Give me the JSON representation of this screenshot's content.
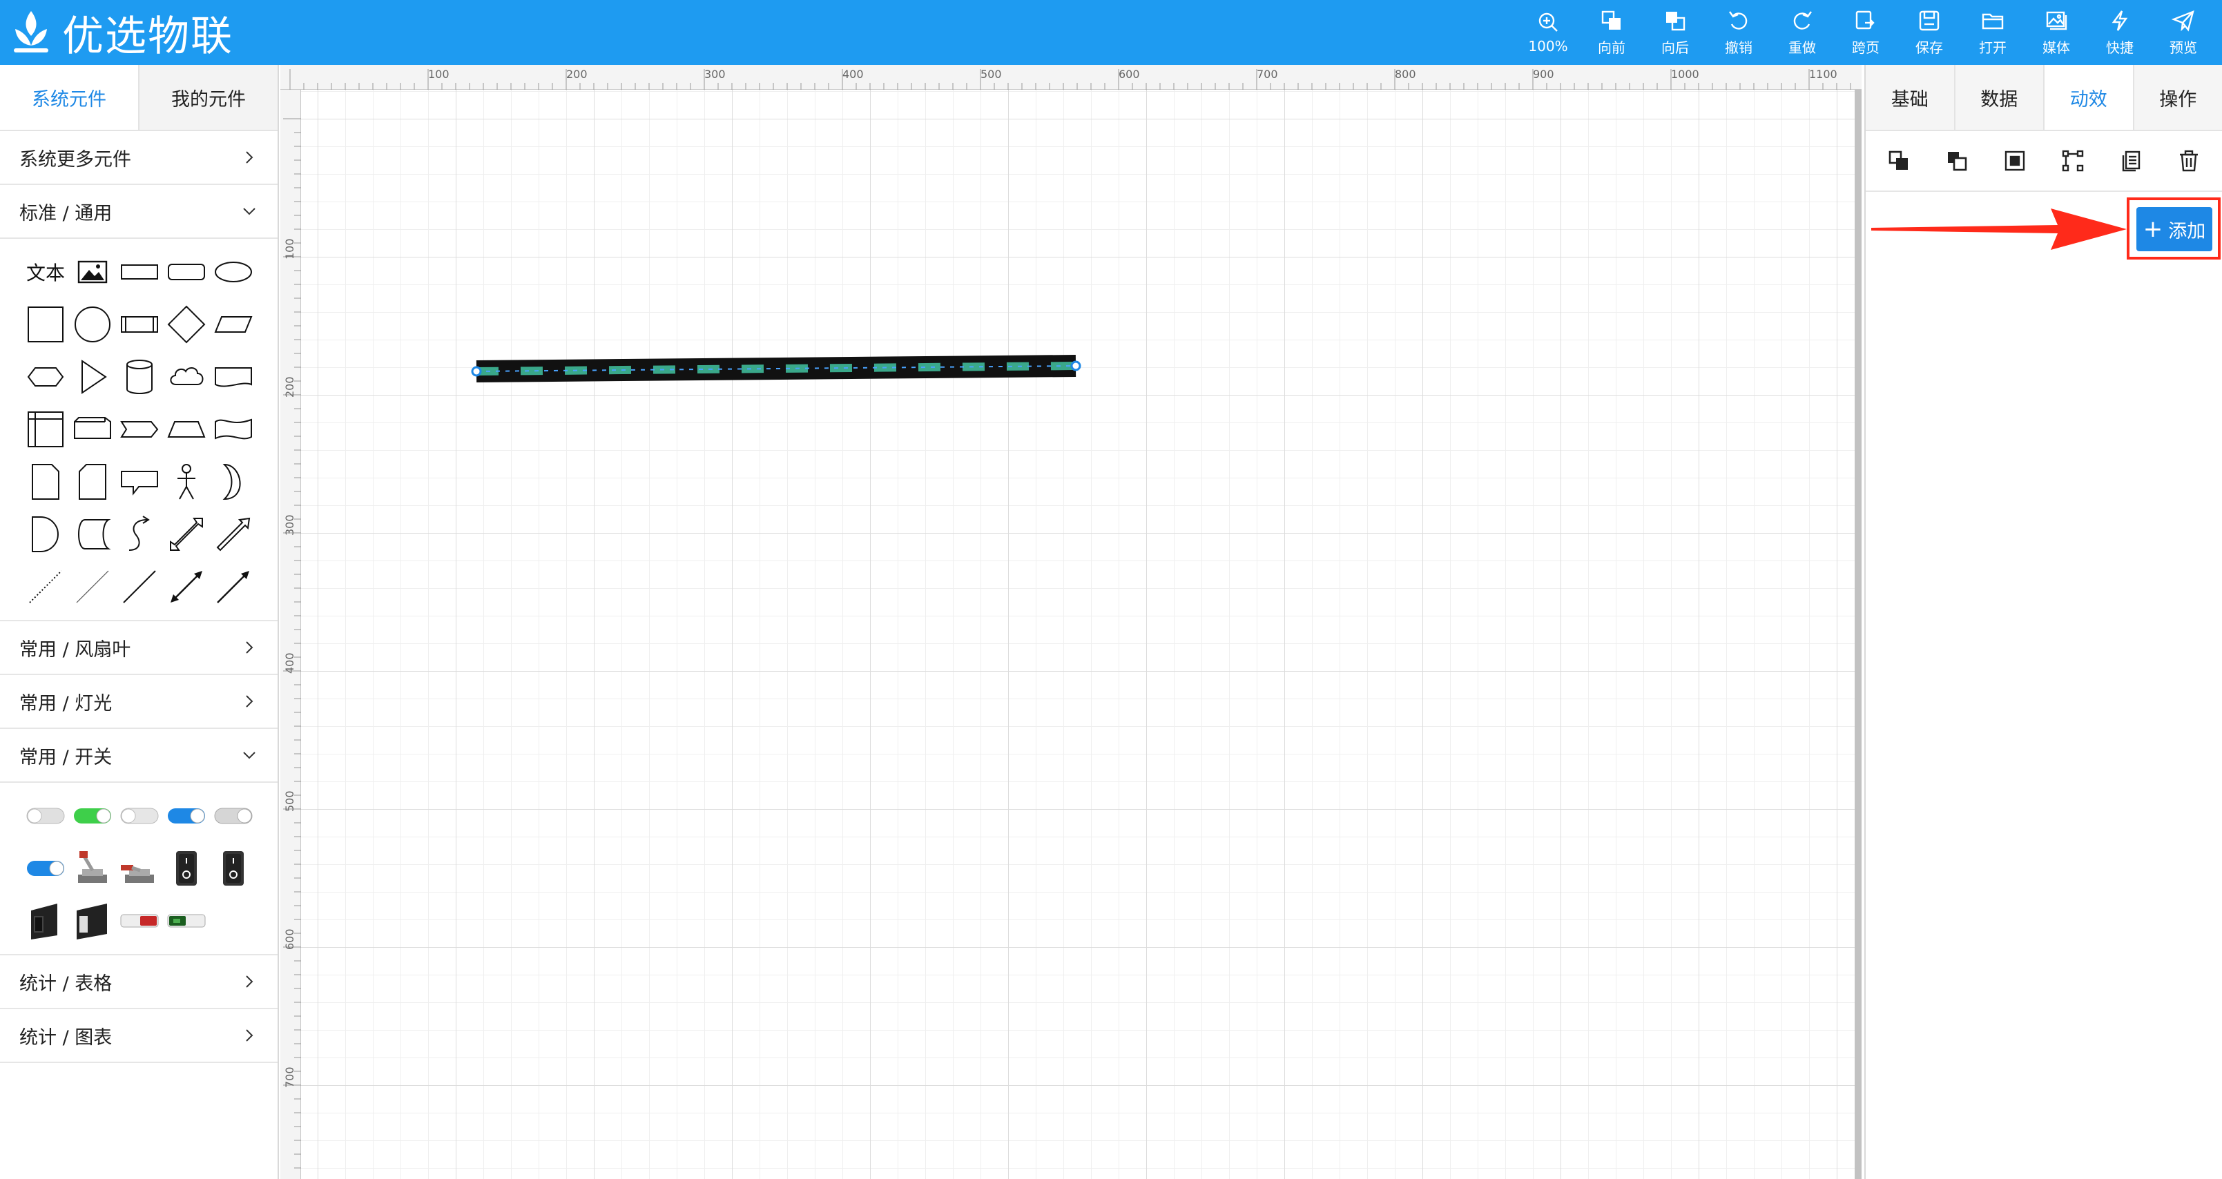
{
  "app": {
    "title": "优选物联"
  },
  "toolbar": [
    {
      "icon": "zoom-in-icon",
      "label": "100%"
    },
    {
      "icon": "bring-forward-icon",
      "label": "向前"
    },
    {
      "icon": "send-backward-icon",
      "label": "向后"
    },
    {
      "icon": "undo-icon",
      "label": "撤销"
    },
    {
      "icon": "redo-icon",
      "label": "重做"
    },
    {
      "icon": "cross-page-icon",
      "label": "跨页"
    },
    {
      "icon": "save-icon",
      "label": "保存"
    },
    {
      "icon": "folder-open-icon",
      "label": "打开"
    },
    {
      "icon": "media-icon",
      "label": "媒体"
    },
    {
      "icon": "lightning-icon",
      "label": "快捷"
    },
    {
      "icon": "paper-plane-icon",
      "label": "预览"
    }
  ],
  "left_panel": {
    "tabs": [
      "系统元件",
      "我的元件"
    ],
    "sections": {
      "more": "系统更多元件",
      "standard": "标准 / 通用",
      "fan": "常用 / 风扇叶",
      "light": "常用 / 灯光",
      "switch": "常用 / 开关",
      "table": "统计 / 表格",
      "chart": "统计 / 图表"
    },
    "text_shape_label": "文本"
  },
  "ruler": {
    "top": [
      "100",
      "200",
      "300",
      "400",
      "500",
      "600",
      "700",
      "800",
      "900",
      "1000",
      "1100"
    ],
    "left": [
      "100",
      "200",
      "300",
      "400",
      "500",
      "600",
      "700"
    ]
  },
  "right_panel": {
    "tabs": [
      "基础",
      "数据",
      "动效",
      "操作"
    ],
    "active_tab": "动效",
    "add_button": {
      "symbol": "+",
      "label": "添加"
    }
  },
  "colors": {
    "accent": "#1e9bf1",
    "button": "#1e88e5",
    "annotation": "#ff2a1a",
    "flow": "#3aa88a"
  }
}
